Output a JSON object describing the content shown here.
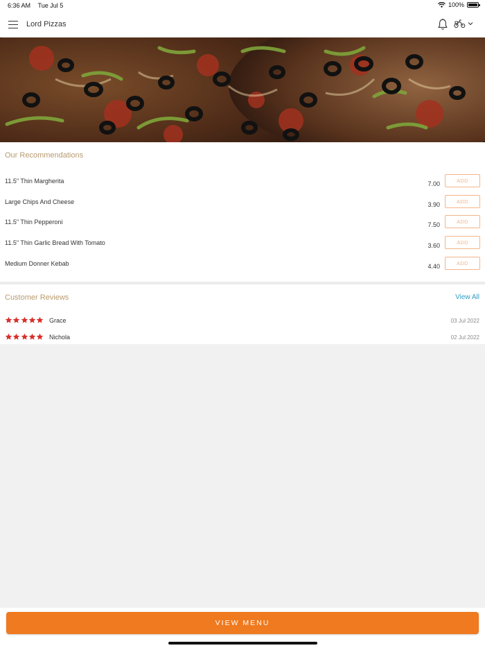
{
  "status_bar": {
    "time": "6:36 AM",
    "date": "Tue Jul 5",
    "battery": "100%",
    "battery_level": 1.0
  },
  "header": {
    "title": "Lord Pizzas",
    "icons": {
      "menu": "hamburger-menu-icon",
      "bell": "bell-icon",
      "mode": "scooter-delivery-icon",
      "caret": "chevron-down-icon"
    }
  },
  "recommendations": {
    "title": "Our Recommendations",
    "items": [
      {
        "name": "11.5\" Thin Margherita",
        "price": "7.00",
        "add_label": "ADD"
      },
      {
        "name": "Large Chips And Cheese",
        "price": "3.90",
        "add_label": "ADD"
      },
      {
        "name": "11.5\" Thin Pepperoni",
        "price": "7.50",
        "add_label": "ADD"
      },
      {
        "name": "11.5\" Thin Garlic Bread With Tomato",
        "price": "3.60",
        "add_label": "ADD"
      },
      {
        "name": "Medium Donner Kebab",
        "price": "4.40",
        "add_label": "ADD"
      }
    ]
  },
  "reviews": {
    "title": "Customer Reviews",
    "view_all_label": "View All",
    "items": [
      {
        "name": "Grace",
        "date": "03 Jul 2022",
        "rating": 5
      },
      {
        "name": "Nichola",
        "date": "02 Jul 2022",
        "rating": 5
      }
    ]
  },
  "footer": {
    "view_menu_label": "VIEW MENU"
  },
  "colors": {
    "accent": "#ef7a1f",
    "section_title": "#b89a6e",
    "link": "#2e9fc4",
    "star": "#d9302c",
    "add_border": "#f3b48a"
  }
}
